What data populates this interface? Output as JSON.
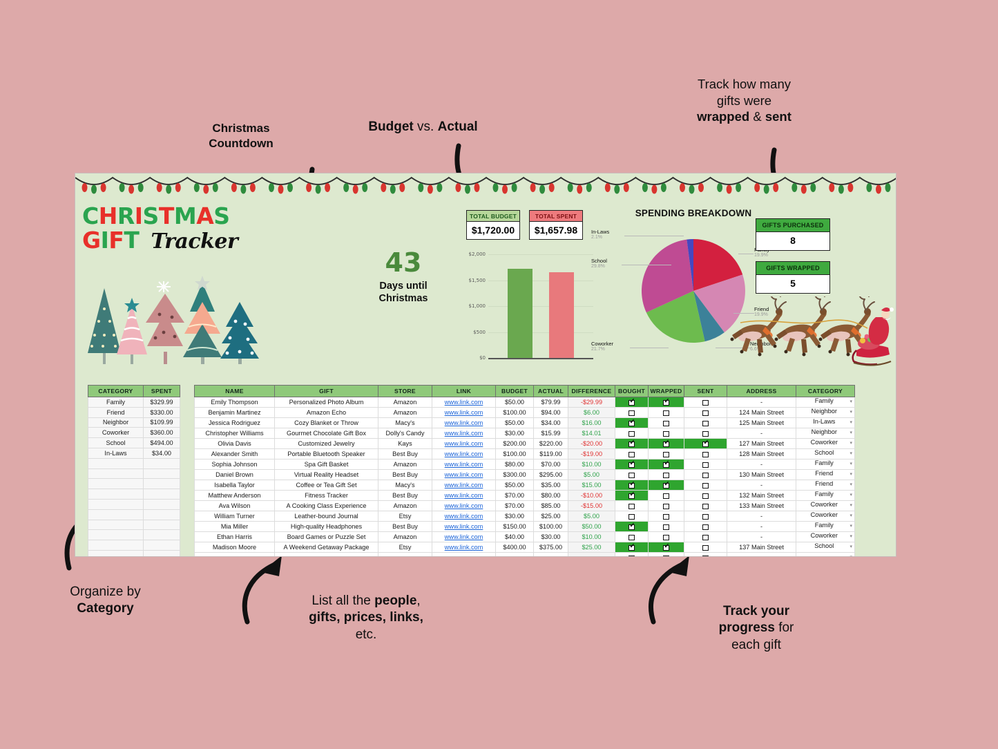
{
  "page": {
    "background_color": "#dda9a9",
    "sheet_background": "#dde9cf"
  },
  "annotations": [
    {
      "id": "christmas-countdown",
      "lines": [
        [
          "Christmas",
          true
        ],
        [
          "Countdown",
          true
        ]
      ]
    },
    {
      "id": "budget-vs-actual",
      "lines": [
        [
          [
            "Budget",
            true
          ],
          [
            "vs.",
            false
          ],
          [
            "Actual",
            true
          ]
        ]
      ]
    },
    {
      "id": "wrapped-sent",
      "lines": [
        [
          "Track how many",
          false
        ],
        [
          "gifts were",
          false
        ],
        [
          "wrapped & sent",
          true
        ]
      ]
    },
    {
      "id": "organize-by-category",
      "lines": [
        [
          "Organize by",
          false
        ],
        [
          "Category",
          true
        ]
      ]
    },
    {
      "id": "list-people",
      "lines": [
        [
          "List all the people,",
          false
        ],
        [
          "gifts, prices, links,",
          true
        ],
        [
          "etc.",
          false
        ]
      ]
    },
    {
      "id": "track-progress",
      "lines": [
        [
          "Track your",
          true
        ],
        [
          "progress for",
          false
        ],
        [
          "each gift",
          false
        ]
      ]
    }
  ],
  "annotation_text": {
    "countdown_l1": "Christmas",
    "countdown_l2": "Countdown",
    "budget_b1": "Budget",
    "budget_mid": " vs. ",
    "budget_b2": "Actual",
    "wrapped_l1": "Track how many",
    "wrapped_l2": "gifts were",
    "wrapped_b1": "wrapped",
    "wrapped_amp": " & ",
    "wrapped_b2": "sent",
    "organize_l1": "Organize by",
    "organize_l2": "Category",
    "list_l1a": "List all the ",
    "list_l1b": "people",
    "list_l1c": ",",
    "list_l2": "gifts, prices, links,",
    "list_l3": "etc.",
    "track_b1": "Track your",
    "track_b2": "progress",
    "track_rest": " for",
    "track_l3": "each gift"
  },
  "logo": {
    "line1": "CHRISTMAS",
    "line2": "GIFT",
    "script": "Tracker"
  },
  "countdown": {
    "days": "43",
    "label_line1": "Days until",
    "label_line2": "Christmas"
  },
  "kpis": [
    {
      "name": "total-budget",
      "label": "TOTAL BUDGET",
      "value": "$1,720.00",
      "color": "#b7d79a"
    },
    {
      "name": "total-spent",
      "label": "TOTAL SPENT",
      "value": "$1,657.98",
      "color": "#ee7b7e"
    }
  ],
  "gift_counters": [
    {
      "name": "gifts-purchased",
      "label": "GIFTS PURCHASED",
      "value": "8"
    },
    {
      "name": "gifts-wrapped",
      "label": "GIFTS WRAPPED",
      "value": "5"
    }
  ],
  "chart_data": [
    {
      "type": "bar",
      "title": "",
      "categories": [
        "Total Budget",
        "Total Spent"
      ],
      "values": [
        1720.0,
        1657.98
      ],
      "colors": [
        "#6aa84f",
        "#e8797c"
      ],
      "ylabel": "",
      "xlabel": "",
      "ylim": [
        0,
        2000
      ],
      "ticks": [
        0,
        500,
        1000,
        1500,
        2000
      ],
      "tick_labels": [
        "$0",
        "$500",
        "$1,000",
        "$1,500",
        "$2,000"
      ],
      "grid": true,
      "legend": "none"
    },
    {
      "type": "pie",
      "title": "SPENDING BREAKDOWN",
      "labels": [
        "Family",
        "Friend",
        "Neighbor",
        "Coworker",
        "School",
        "In-Laws"
      ],
      "values": [
        329.99,
        330.0,
        109.99,
        360.0,
        494.0,
        34.0
      ],
      "percent_labels": [
        "19.9%",
        "19.9%",
        "6.6%",
        "21.7%",
        "29.8%",
        "2.1%"
      ],
      "colors": [
        "#d3203f",
        "#d587b3",
        "#3c8199",
        "#6dbb4e",
        "#bf4b93",
        "#4647c0"
      ],
      "legend": "labels-around-pie"
    }
  ],
  "category_table": {
    "headers": [
      "CATEGORY",
      "SPENT"
    ],
    "rows": [
      [
        "Family",
        "$329.99"
      ],
      [
        "Friend",
        "$330.00"
      ],
      [
        "Neighbor",
        "$109.99"
      ],
      [
        "Coworker",
        "$360.00"
      ],
      [
        "School",
        "$494.00"
      ],
      [
        "In-Laws",
        "$34.00"
      ],
      [
        "",
        ""
      ],
      [
        "",
        ""
      ],
      [
        "",
        ""
      ],
      [
        "",
        ""
      ],
      [
        "",
        ""
      ],
      [
        "",
        ""
      ],
      [
        "",
        ""
      ],
      [
        "",
        ""
      ],
      [
        "",
        ""
      ],
      [
        "",
        ""
      ]
    ]
  },
  "main_table": {
    "headers": [
      "NAME",
      "GIFT",
      "STORE",
      "LINK",
      "BUDGET",
      "ACTUAL",
      "DIFFERENCE",
      "BOUGHT",
      "WRAPPED",
      "SENT",
      "ADDRESS",
      "CATEGORY"
    ],
    "link_text": "www.link.com",
    "rows": [
      {
        "name": "Emily Thompson",
        "gift": "Personalized Photo Album",
        "store": "Amazon",
        "link": "www.link.com",
        "budget": "$50.00",
        "actual": "$79.99",
        "difference": "-$29.99",
        "neg": true,
        "bought": true,
        "wrapped": true,
        "sent": false,
        "address": "-",
        "category": "Family"
      },
      {
        "name": "Benjamin Martinez",
        "gift": "Amazon Echo",
        "store": "Amazon",
        "link": "www.link.com",
        "budget": "$100.00",
        "actual": "$94.00",
        "difference": "$6.00",
        "neg": false,
        "bought": false,
        "wrapped": false,
        "sent": false,
        "address": "124 Main Street",
        "category": "Neighbor"
      },
      {
        "name": "Jessica Rodriguez",
        "gift": "Cozy Blanket or Throw",
        "store": "Macy's",
        "link": "www.link.com",
        "budget": "$50.00",
        "actual": "$34.00",
        "difference": "$16.00",
        "neg": false,
        "bought": true,
        "wrapped": false,
        "sent": false,
        "address": "125 Main Street",
        "category": "In-Laws"
      },
      {
        "name": "Christopher Williams",
        "gift": "Gourmet Chocolate Gift Box",
        "store": "Dolly's Candy",
        "link": "www.link.com",
        "budget": "$30.00",
        "actual": "$15.99",
        "difference": "$14.01",
        "neg": false,
        "bought": false,
        "wrapped": false,
        "sent": false,
        "address": "-",
        "category": "Neighbor"
      },
      {
        "name": "Olivia Davis",
        "gift": "Customized Jewelry",
        "store": "Kays",
        "link": "www.link.com",
        "budget": "$200.00",
        "actual": "$220.00",
        "difference": "-$20.00",
        "neg": true,
        "bought": true,
        "wrapped": true,
        "sent": true,
        "address": "127 Main Street",
        "category": "Coworker"
      },
      {
        "name": "Alexander Smith",
        "gift": "Portable Bluetooth Speaker",
        "store": "Best Buy",
        "link": "www.link.com",
        "budget": "$100.00",
        "actual": "$119.00",
        "difference": "-$19.00",
        "neg": true,
        "bought": false,
        "wrapped": false,
        "sent": false,
        "address": "128 Main Street",
        "category": "School"
      },
      {
        "name": "Sophia Johnson",
        "gift": "Spa Gift Basket",
        "store": "Amazon",
        "link": "www.link.com",
        "budget": "$80.00",
        "actual": "$70.00",
        "difference": "$10.00",
        "neg": false,
        "bought": true,
        "wrapped": true,
        "sent": false,
        "address": "-",
        "category": "Family"
      },
      {
        "name": "Daniel Brown",
        "gift": "Virtual Reality Headset",
        "store": "Best Buy",
        "link": "www.link.com",
        "budget": "$300.00",
        "actual": "$295.00",
        "difference": "$5.00",
        "neg": false,
        "bought": false,
        "wrapped": false,
        "sent": false,
        "address": "130 Main Street",
        "category": "Friend"
      },
      {
        "name": "Isabella Taylor",
        "gift": "Coffee or Tea Gift Set",
        "store": "Macy's",
        "link": "www.link.com",
        "budget": "$50.00",
        "actual": "$35.00",
        "difference": "$15.00",
        "neg": false,
        "bought": true,
        "wrapped": true,
        "sent": false,
        "address": "-",
        "category": "Friend"
      },
      {
        "name": "Matthew Anderson",
        "gift": "Fitness Tracker",
        "store": "Best Buy",
        "link": "www.link.com",
        "budget": "$70.00",
        "actual": "$80.00",
        "difference": "-$10.00",
        "neg": true,
        "bought": true,
        "wrapped": false,
        "sent": false,
        "address": "132 Main Street",
        "category": "Family"
      },
      {
        "name": "Ava Wilson",
        "gift": "A Cooking Class Experience",
        "store": "Amazon",
        "link": "www.link.com",
        "budget": "$70.00",
        "actual": "$85.00",
        "difference": "-$15.00",
        "neg": true,
        "bought": false,
        "wrapped": false,
        "sent": false,
        "address": "133 Main Street",
        "category": "Coworker"
      },
      {
        "name": "William Turner",
        "gift": "Leather-bound Journal",
        "store": "Etsy",
        "link": "www.link.com",
        "budget": "$30.00",
        "actual": "$25.00",
        "difference": "$5.00",
        "neg": false,
        "bought": false,
        "wrapped": false,
        "sent": false,
        "address": "-",
        "category": "Coworker"
      },
      {
        "name": "Mia Miller",
        "gift": "High-quality Headphones",
        "store": "Best Buy",
        "link": "www.link.com",
        "budget": "$150.00",
        "actual": "$100.00",
        "difference": "$50.00",
        "neg": false,
        "bought": true,
        "wrapped": false,
        "sent": false,
        "address": "-",
        "category": "Family"
      },
      {
        "name": "Ethan Harris",
        "gift": "Board Games or Puzzle Set",
        "store": "Amazon",
        "link": "www.link.com",
        "budget": "$40.00",
        "actual": "$30.00",
        "difference": "$10.00",
        "neg": false,
        "bought": false,
        "wrapped": false,
        "sent": false,
        "address": "-",
        "category": "Coworker"
      },
      {
        "name": "Madison Moore",
        "gift": "A Weekend Getaway Package",
        "store": "Etsy",
        "link": "www.link.com",
        "budget": "$400.00",
        "actual": "$375.00",
        "difference": "$25.00",
        "neg": false,
        "bought": true,
        "wrapped": true,
        "sent": false,
        "address": "137 Main Street",
        "category": "School"
      },
      {
        "name": "",
        "gift": "",
        "store": "",
        "link": "",
        "budget": "",
        "actual": "",
        "difference": "",
        "neg": false,
        "bought": false,
        "wrapped": false,
        "sent": false,
        "address": "",
        "category": ""
      },
      {
        "name": "",
        "gift": "",
        "store": "",
        "link": "",
        "budget": "",
        "actual": "",
        "difference": "",
        "neg": false,
        "bought": false,
        "wrapped": false,
        "sent": false,
        "address": "",
        "category": ""
      }
    ]
  },
  "decorations": {
    "lights": "christmas-lights-garland",
    "santa": "santa-sleigh-reindeer",
    "trees": "christmas-trees-illustration"
  }
}
